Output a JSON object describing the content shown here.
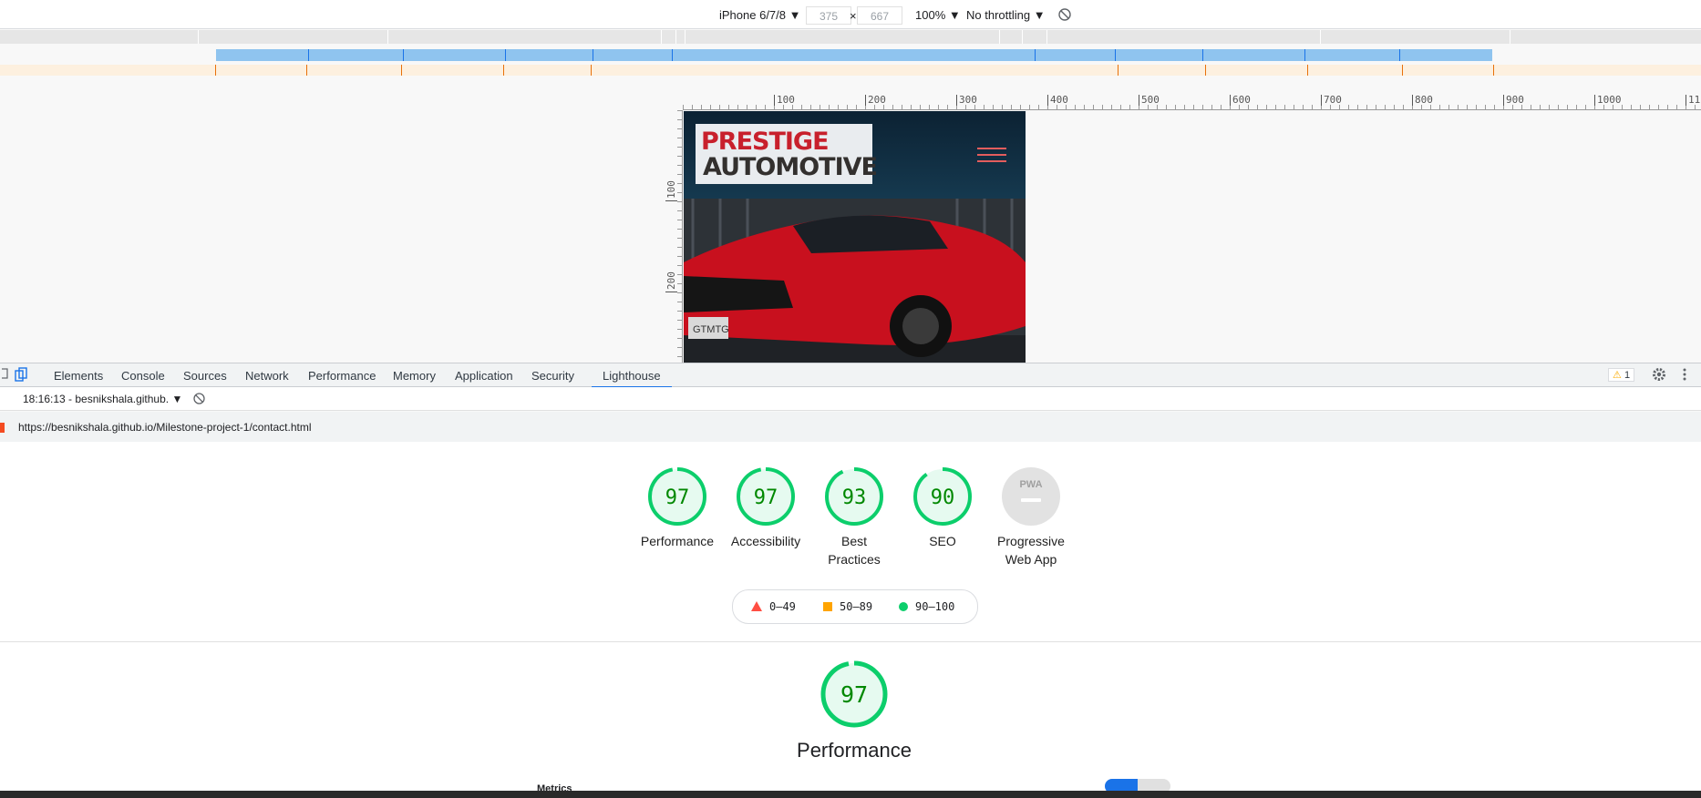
{
  "device_toolbar": {
    "device": "iPhone 6/7/8 ▼",
    "width": "375",
    "times": "×",
    "height": "667",
    "zoom": "100% ▼",
    "throttling": "No throttling ▼",
    "rotate_icon": "rotate-icon"
  },
  "rulers": {
    "top": [
      "100",
      "200",
      "300",
      "400",
      "500",
      "600",
      "700",
      "800",
      "900",
      "1000",
      "11"
    ],
    "left": [
      "100",
      "200"
    ]
  },
  "site": {
    "logo_line1": "PRESTIGE",
    "logo_line2": "AUTOMOTIVE",
    "plate": "GTMTG",
    "menu_icon": "hamburger-menu-icon"
  },
  "devtools": {
    "tabs": [
      "Elements",
      "Console",
      "Sources",
      "Network",
      "Performance",
      "Memory",
      "Application",
      "Security",
      "Lighthouse"
    ],
    "active_tab": "Lighthouse",
    "warning_count": "1",
    "report_selector": "18:16:13 - besnikshala.github. ▼",
    "url": "https://besnikshala.github.io/Milestone-project-1/contact.html"
  },
  "scores": [
    {
      "label": "Performance",
      "value": "97"
    },
    {
      "label": "Accessibility",
      "value": "97"
    },
    {
      "label": "Best Practices",
      "value": "93"
    },
    {
      "label": "SEO",
      "value": "90"
    },
    {
      "label": "Progressive Web App",
      "value": "PWA"
    }
  ],
  "legend": {
    "fail": "0–49",
    "average": "50–89",
    "pass": "90–100"
  },
  "performance_section": {
    "score": "97",
    "title": "Performance",
    "metrics_label": "Metrics"
  },
  "colors": {
    "pass": "#0cce6b",
    "pass_bg": "#e6faf0",
    "pass_text": "#008800",
    "average": "#ffa400",
    "fail": "#ff4e42",
    "accent": "#1a73e8"
  }
}
